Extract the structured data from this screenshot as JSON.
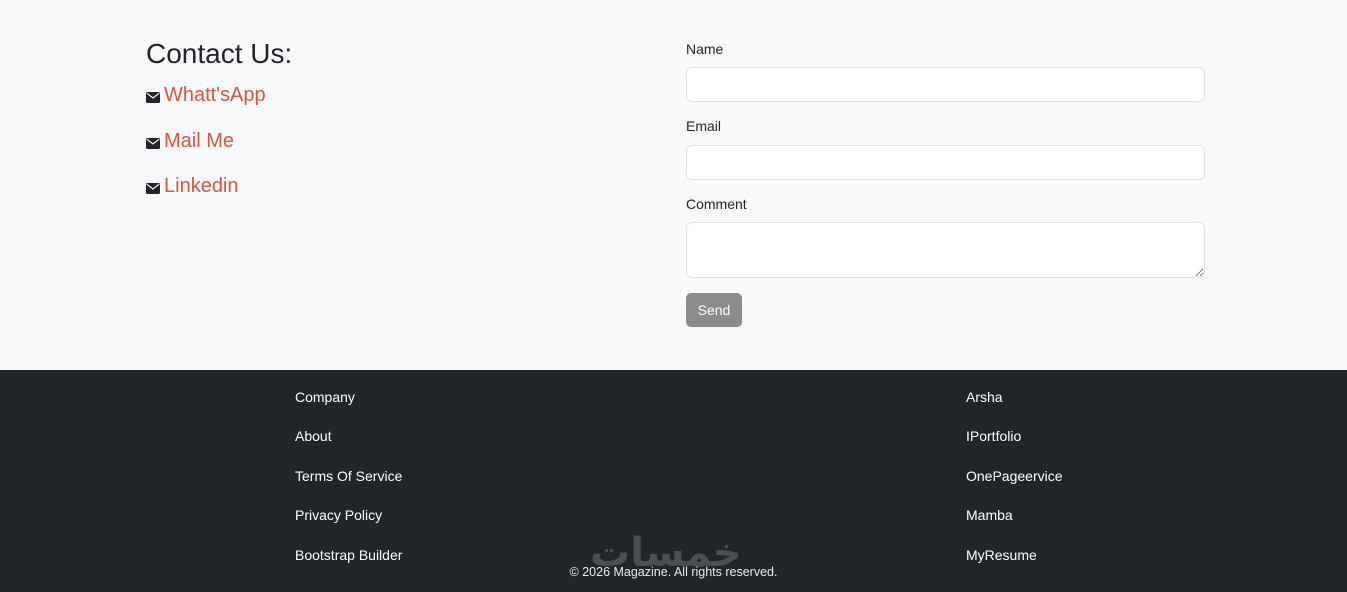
{
  "contact": {
    "title": "Contact Us:",
    "links": [
      {
        "label": "Whatt'sApp",
        "icon": "envelope-icon"
      },
      {
        "label": "Mail Me",
        "icon": "envelope-icon"
      },
      {
        "label": "Linkedin",
        "icon": "envelope-icon"
      }
    ]
  },
  "form": {
    "name_label": "Name",
    "name_value": "",
    "email_label": "Email",
    "email_value": "",
    "comment_label": "Comment",
    "comment_value": "",
    "send_label": "Send"
  },
  "footer": {
    "left_links": [
      "Company",
      "About",
      "Terms Of Service",
      "Privacy Policy",
      "Bootstrap Builder"
    ],
    "right_links": [
      "Arsha",
      "IPortfolio",
      "OnePageervice",
      "Mamba",
      "MyResume"
    ],
    "watermark": "خمسات",
    "copyright": "© 2026 Magazine. All rights reserved."
  },
  "colors": {
    "link": "#d9533f",
    "footer_bg": "#212529",
    "button": "#8a8b8d"
  }
}
